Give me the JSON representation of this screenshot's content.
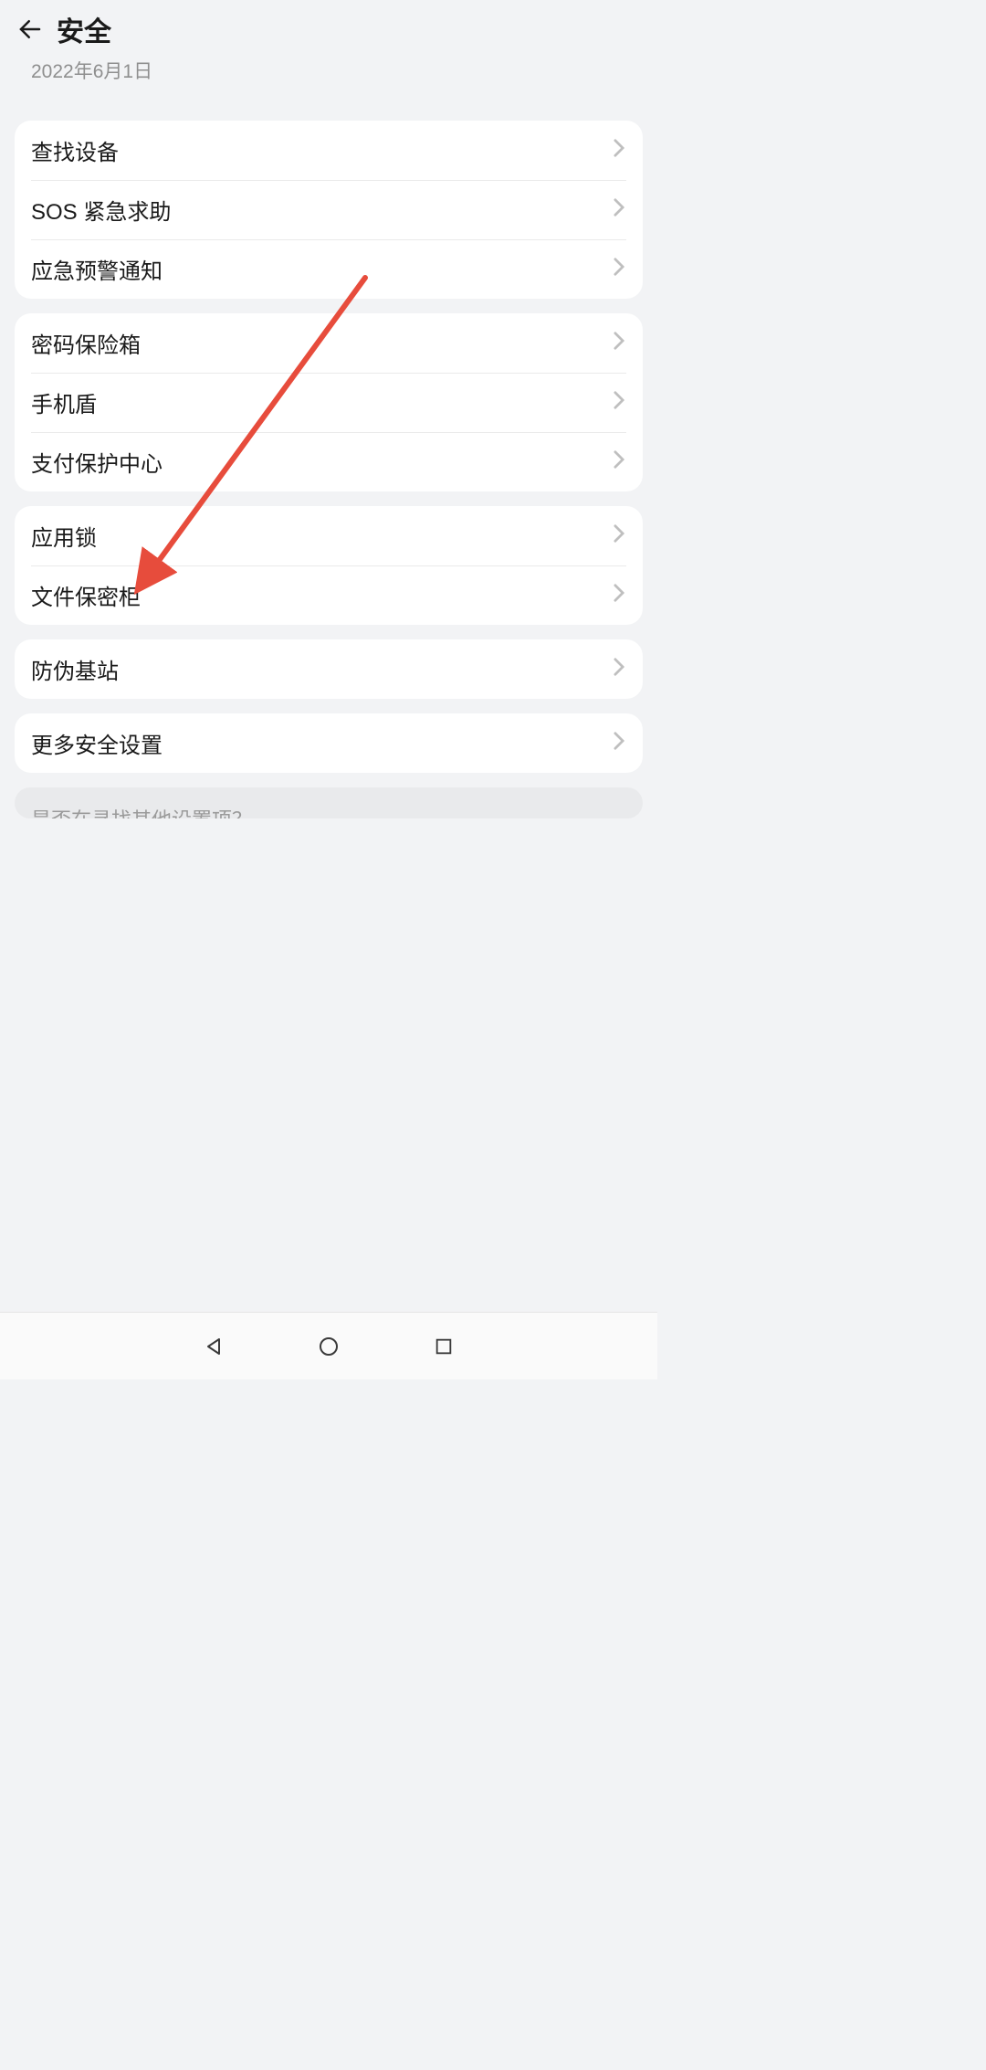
{
  "header": {
    "title": "安全",
    "subtitle": "2022年6月1日"
  },
  "groups": [
    {
      "items": [
        {
          "key": "find-device",
          "label": "查找设备"
        },
        {
          "key": "sos",
          "label": "SOS 紧急求助"
        },
        {
          "key": "emergency-alert",
          "label": "应急预警通知"
        }
      ]
    },
    {
      "items": [
        {
          "key": "password-vault",
          "label": "密码保险箱"
        },
        {
          "key": "phone-shield",
          "label": "手机盾"
        },
        {
          "key": "payment-protection",
          "label": "支付保护中心"
        }
      ]
    },
    {
      "items": [
        {
          "key": "app-lock",
          "label": "应用锁"
        },
        {
          "key": "file-safe",
          "label": "文件保密柜"
        }
      ]
    },
    {
      "items": [
        {
          "key": "fake-base-station",
          "label": "防伪基站"
        }
      ]
    },
    {
      "items": [
        {
          "key": "more-security",
          "label": "更多安全设置"
        }
      ]
    }
  ],
  "footer_hint": "是否在寻找其他设置项？",
  "annotation": {
    "arrow_color": "#e74c3c"
  }
}
